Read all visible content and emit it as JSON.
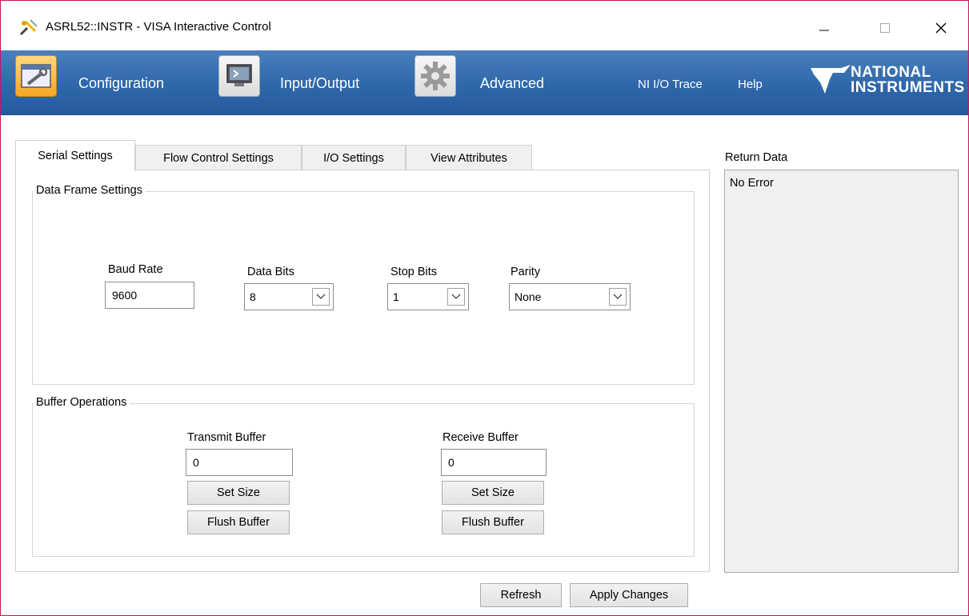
{
  "window": {
    "title": "ASRL52::INSTR - VISA Interactive Control"
  },
  "toolbar": {
    "configuration_label": "Configuration",
    "input_output_label": "Input/Output",
    "advanced_label": "Advanced",
    "ni_io_trace_label": "NI I/O Trace",
    "help_label": "Help",
    "logo_line1": "NATIONAL",
    "logo_line2": "INSTRUMENTS"
  },
  "tabs": [
    {
      "label": "Serial Settings",
      "active": true
    },
    {
      "label": "Flow Control Settings",
      "active": false
    },
    {
      "label": "I/O Settings",
      "active": false
    },
    {
      "label": "View Attributes",
      "active": false
    }
  ],
  "data_frame": {
    "group_title": "Data Frame Settings",
    "baud_rate_label": "Baud Rate",
    "baud_rate_value": "9600",
    "data_bits_label": "Data Bits",
    "data_bits_value": "8",
    "stop_bits_label": "Stop Bits",
    "stop_bits_value": "1",
    "parity_label": "Parity",
    "parity_value": "None"
  },
  "buffer_ops": {
    "group_title": "Buffer Operations",
    "transmit_label": "Transmit Buffer",
    "transmit_value": "0",
    "receive_label": "Receive Buffer",
    "receive_value": "0",
    "set_size_label": "Set Size",
    "flush_label": "Flush Buffer"
  },
  "return_data": {
    "label": "Return Data",
    "text": "No Error"
  },
  "footer": {
    "refresh_label": "Refresh",
    "apply_label": "Apply Changes"
  },
  "colors": {
    "toolbar_blue": "#2f67aa",
    "active_icon": "#f5a623",
    "window_border": "#c2185b"
  }
}
